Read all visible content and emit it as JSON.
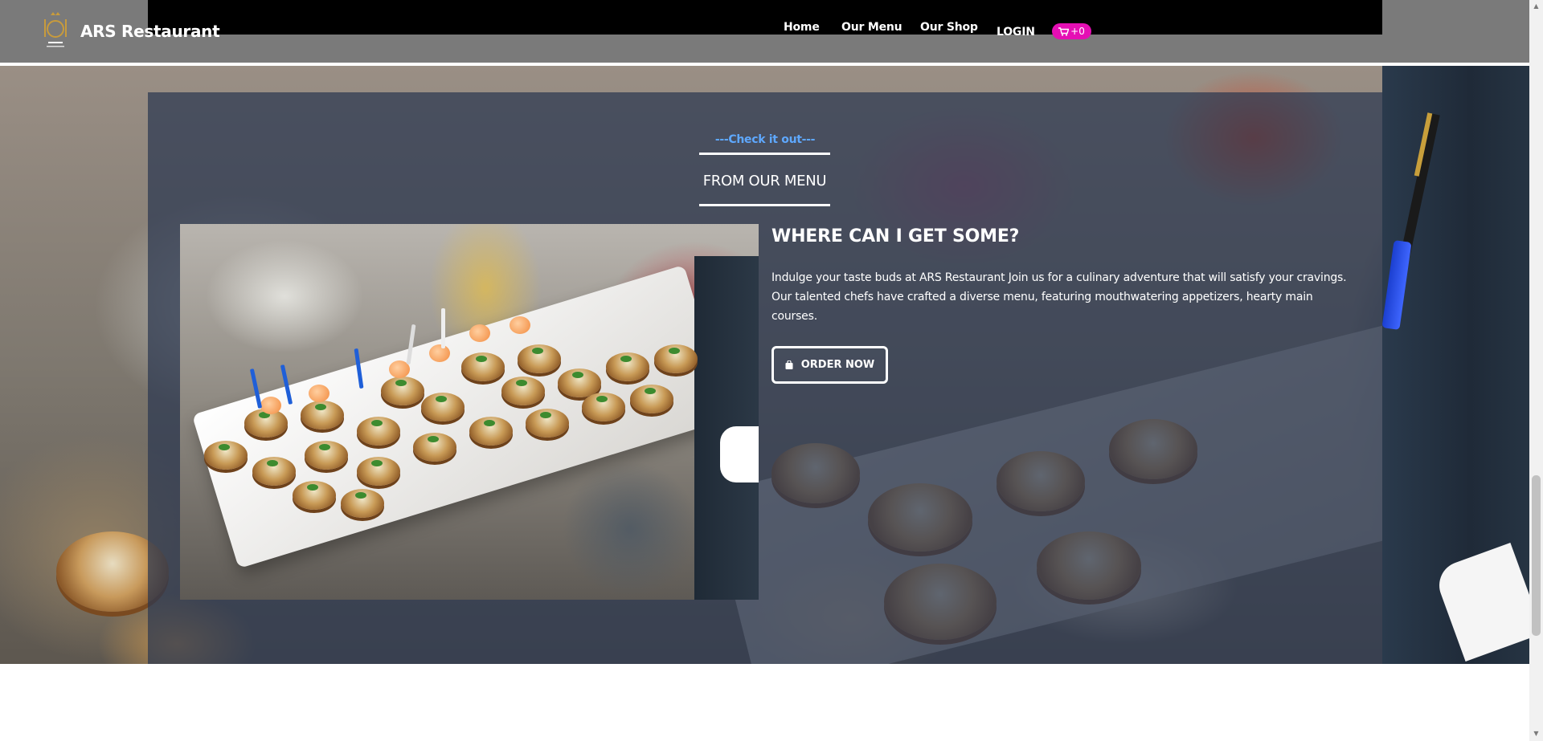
{
  "header": {
    "brand": "ARS Restaurant",
    "nav": {
      "home": "Home",
      "menu": "Our Menu",
      "shop": "Our Shop",
      "login": "LOGIN"
    },
    "cart_count": "+0",
    "logo_icon": "restaurant-logo-icon",
    "cart_icon": "cart-icon"
  },
  "section": {
    "subtitle": "---Check it out---",
    "title": "FROM OUR MENU"
  },
  "content": {
    "heading": "WHERE CAN I GET SOME?",
    "body": "Indulge your taste buds at ARS Restaurant Join us for a culinary adventure that will satisfy your cravings. Our talented chefs have crafted a diverse menu, featuring mouthwatering appetizers, hearty main courses.",
    "button_label": "ORDER NOW",
    "button_icon": "shopping-bag-icon"
  },
  "colors": {
    "header_bg": "#7a7a7a",
    "accent_pink": "#e50fb4",
    "accent_blue": "#5ea8ff",
    "overlay": "#2b3750"
  }
}
